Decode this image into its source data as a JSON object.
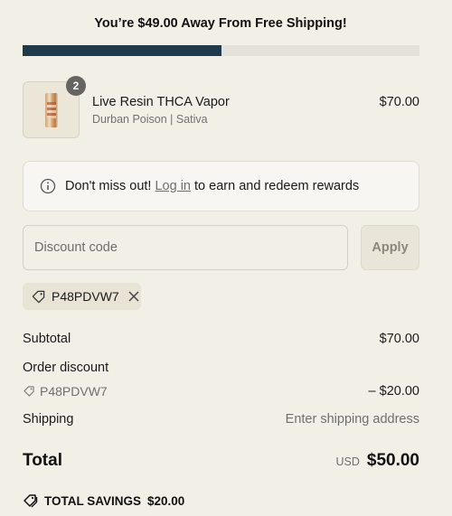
{
  "shipping_banner": {
    "message": "You’re $49.00 Away From Free Shipping!",
    "progress": 0.5,
    "bar_color": "#1f3a4d",
    "track_color": "#e4e1da"
  },
  "cart_item": {
    "quantity": "2",
    "name": "Live Resin THCA Vapor",
    "variant": "Durban Poison | Sativa",
    "price": "$70.00"
  },
  "rewards_notice": {
    "prefix": "Don't miss out!",
    "link": "Log in",
    "suffix": "to earn and redeem rewards",
    "icon": "info-icon"
  },
  "discount": {
    "placeholder": "Discount code",
    "apply_label": "Apply",
    "applied_code": "P48PDVW7"
  },
  "summary": {
    "subtotal_label": "Subtotal",
    "subtotal_value": "$70.00",
    "order_discount_label": "Order discount",
    "discount_code": "P48PDVW7",
    "discount_value": "– $20.00",
    "shipping_label": "Shipping",
    "shipping_value": "Enter shipping address",
    "total_label": "Total",
    "total_currency": "USD",
    "total_value": "$50.00",
    "savings_label": "TOTAL SAVINGS",
    "savings_value": "$20.00"
  }
}
